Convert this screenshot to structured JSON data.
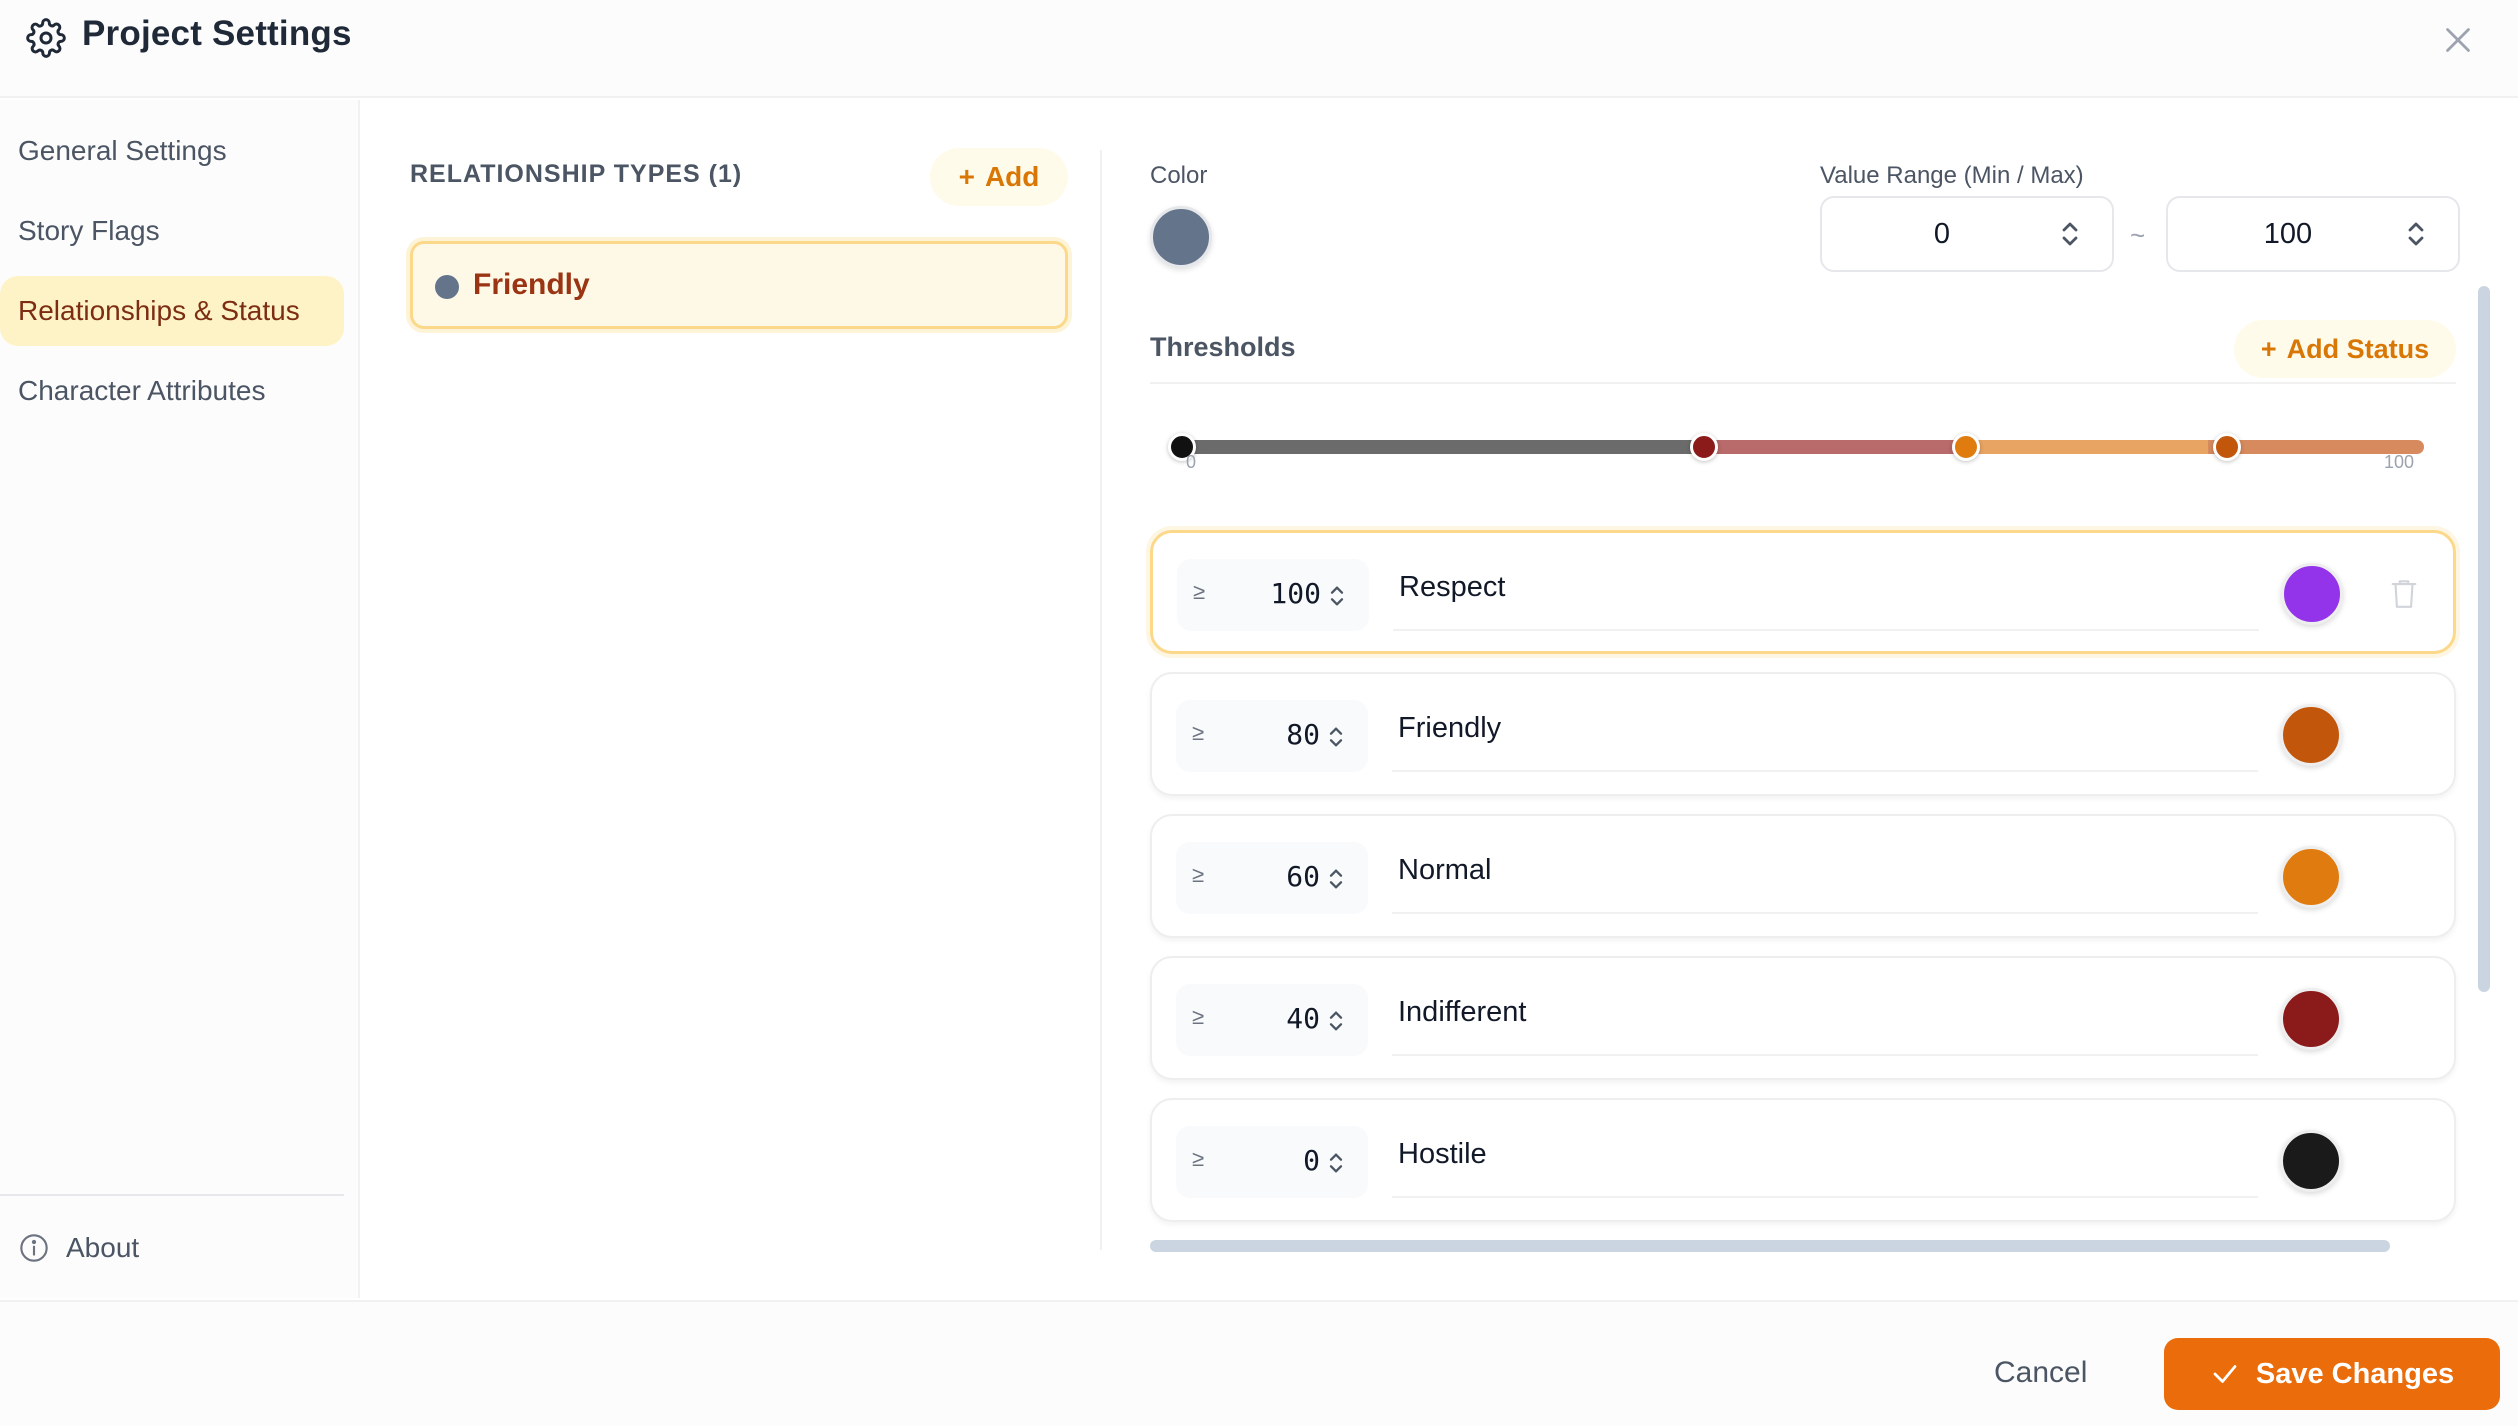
{
  "header": {
    "title": "Project Settings",
    "settings_icon": "gear-icon",
    "close_icon": "close-icon"
  },
  "sidebar": {
    "items": [
      {
        "label": "General Settings",
        "active": false
      },
      {
        "label": "Story Flags",
        "active": false
      },
      {
        "label": "Relationships & Status",
        "active": true
      },
      {
        "label": "Character Attributes",
        "active": false
      }
    ],
    "about_label": "About",
    "about_icon": "info-icon"
  },
  "types": {
    "header": "RELATIONSHIP TYPES (1)",
    "add_label": "Add",
    "items": [
      {
        "name": "Friendly",
        "color": "#64748b"
      }
    ]
  },
  "editor": {
    "color_label": "Color",
    "color_value": "#64748b",
    "range_label": "Value Range (Min / Max)",
    "min": "0",
    "max": "100",
    "range_separator": "~",
    "thresholds_label": "Thresholds",
    "add_status_label": "Add Status",
    "slider": {
      "min_tick": "0",
      "max_tick": "100",
      "knob_values": [
        0,
        40,
        60,
        80
      ],
      "knob_colors": [
        "#111111",
        "#8b1a1a",
        "#e07b10",
        "#c2570c"
      ]
    },
    "thresholds": [
      {
        "op": "≥",
        "value": "100",
        "label": "Respect",
        "color": "#9333ea",
        "selected": true
      },
      {
        "op": "≥",
        "value": "80",
        "label": "Friendly",
        "color": "#c2570c",
        "selected": false
      },
      {
        "op": "≥",
        "value": "60",
        "label": "Normal",
        "color": "#e07b10",
        "selected": false
      },
      {
        "op": "≥",
        "value": "40",
        "label": "Indifferent",
        "color": "#8b1a1a",
        "selected": false
      },
      {
        "op": "≥",
        "value": "0",
        "label": "Hostile",
        "color": "#1a1a1a",
        "selected": false
      }
    ]
  },
  "footer": {
    "cancel_label": "Cancel",
    "save_label": "Save Changes"
  }
}
